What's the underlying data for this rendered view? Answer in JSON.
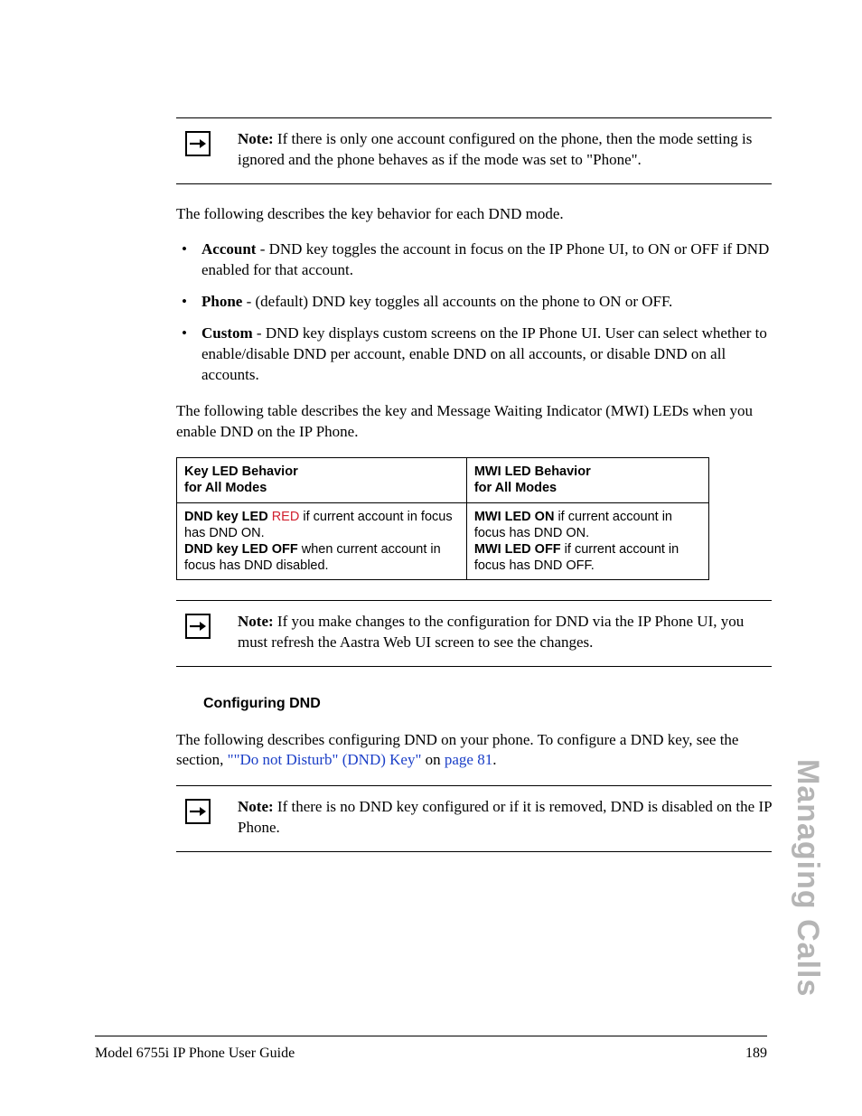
{
  "notes": {
    "n1_label": "Note:",
    "n1_text": " If there is only one account configured on the phone, then the mode setting is ignored and the phone behaves as if the mode was set to \"Phone\".",
    "n2_label": "Note:",
    "n2_text": " If you make changes to the configuration for DND via the IP Phone UI, you must refresh the Aastra Web UI screen to see the changes.",
    "n3_label": "Note:",
    "n3_text": " If there is no DND key configured or if it is removed, DND is disabled on the IP Phone."
  },
  "p1": "The following describes the key behavior for each DND mode.",
  "bullets": {
    "b1_label": "Account",
    "b1_text": " - DND key toggles the account in focus on the IP Phone UI, to ON or OFF if DND enabled for that account.",
    "b2_label": "Phone",
    "b2_text": " - (default) DND key toggles all accounts on the phone to ON or OFF.",
    "b3_label": "Custom",
    "b3_text": " - DND key displays custom screens on the IP Phone UI. User can select whether to enable/disable DND per account, enable DND on all accounts, or disable DND on all accounts."
  },
  "p2": "The following table describes the key and Message Waiting Indicator (MWI) LEDs when you enable DND on the IP Phone.",
  "table": {
    "h1a": "Key LED Behavior",
    "h1b": "for All Modes",
    "h2a": "MWI LED Behavior",
    "h2b": "for All Modes",
    "c1_pre": "DND key LED ",
    "c1_red": "RED",
    "c1_post": " if current account in focus has DND ON.",
    "c1_b2": "DND key LED OFF",
    "c1_post2": " when current account in focus has DND disabled.",
    "c2_b1": "MWI LED ON",
    "c2_t1": " if current account in focus has DND ON.",
    "c2_b2": "MWI LED OFF",
    "c2_t2": " if current account in focus has DND OFF."
  },
  "section": "Configuring DND",
  "p3a": "The following describes configuring DND on your phone. To configure a DND key, see the section, ",
  "link1": "\"\"Do not Disturb\" (DND) Key\"",
  "p3b": " on ",
  "link2": "page 81",
  "p3c": ".",
  "sidetab": "Managing Calls",
  "footer_left": "Model 6755i IP Phone User Guide",
  "footer_right": "189"
}
